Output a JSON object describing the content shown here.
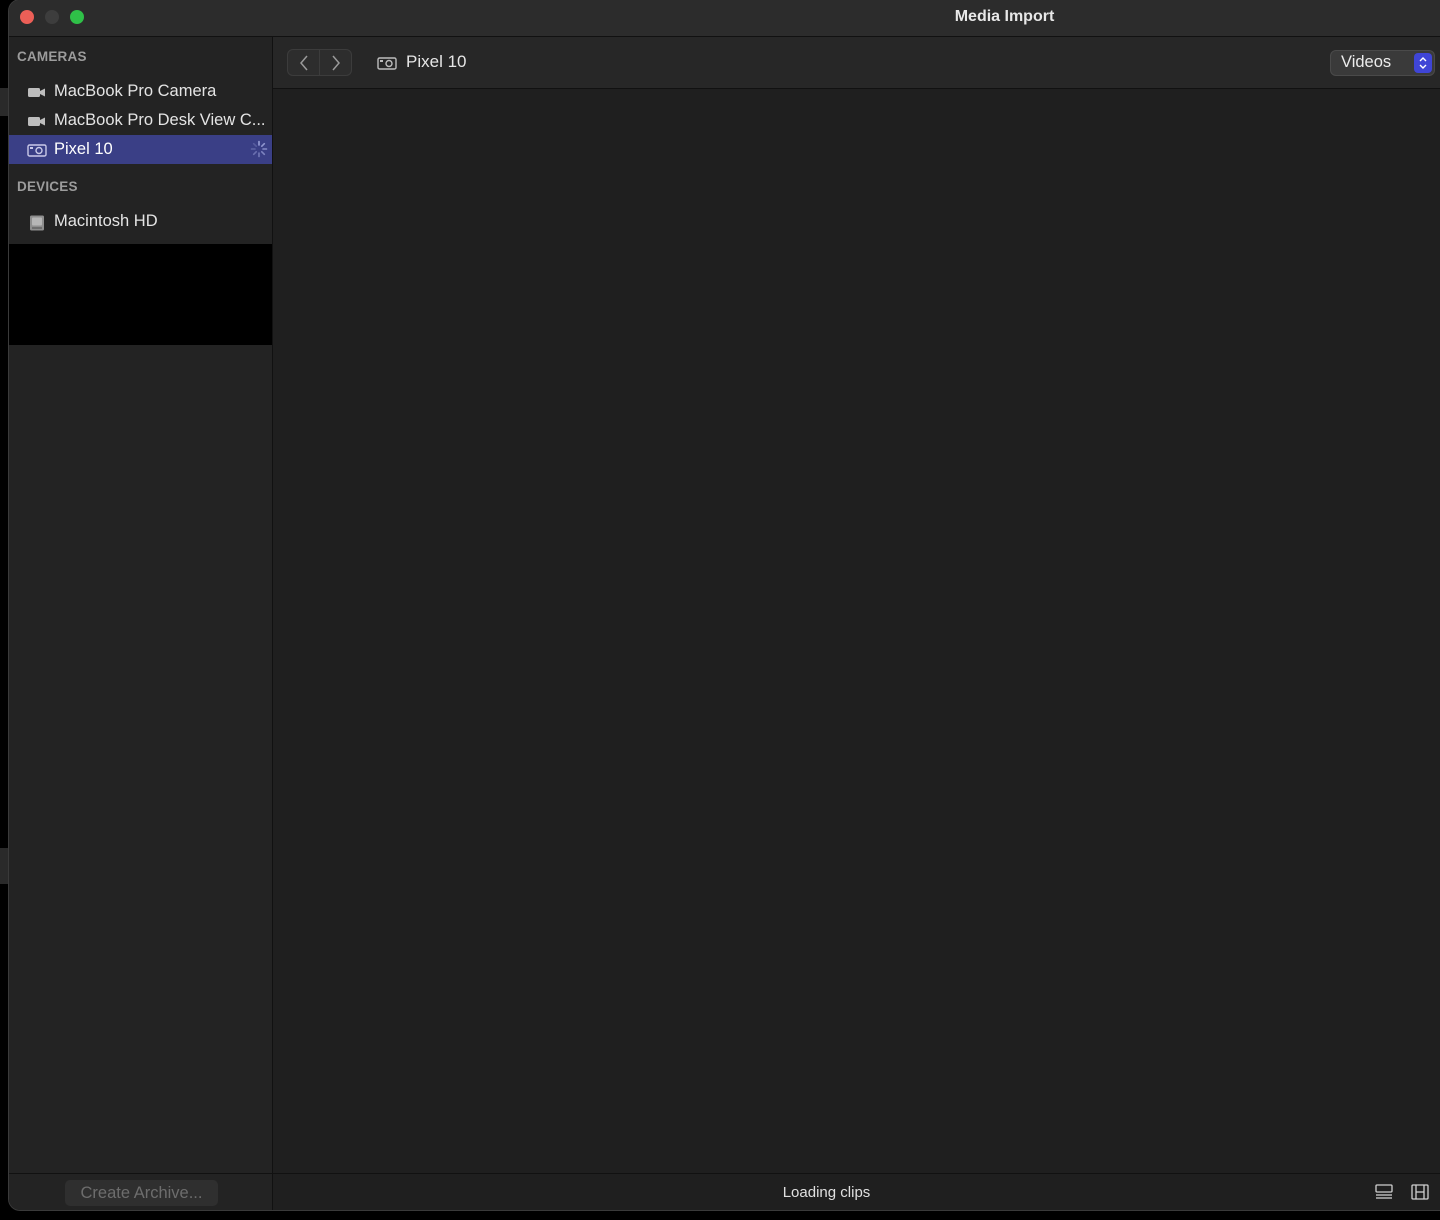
{
  "window": {
    "title": "Media Import"
  },
  "sidebar": {
    "cameras_header": "CAMERAS",
    "devices_header": "DEVICES",
    "cameras": [
      {
        "label": "MacBook Pro Camera",
        "icon": "video-camera-icon"
      },
      {
        "label": "MacBook Pro Desk View C...",
        "icon": "video-camera-icon"
      },
      {
        "label": "Pixel 10",
        "icon": "camera-device-icon",
        "selected": true,
        "loading": true
      }
    ],
    "devices": [
      {
        "label": "Macintosh HD",
        "icon": "hard-drive-icon"
      }
    ],
    "archive_button": "Create Archive..."
  },
  "toolbar": {
    "breadcrumb": "Pixel 10",
    "filter_value": "Videos"
  },
  "status": {
    "text": "Loading clips"
  },
  "colors": {
    "selection": "#3a3f86",
    "accent": "#3f45d6"
  }
}
